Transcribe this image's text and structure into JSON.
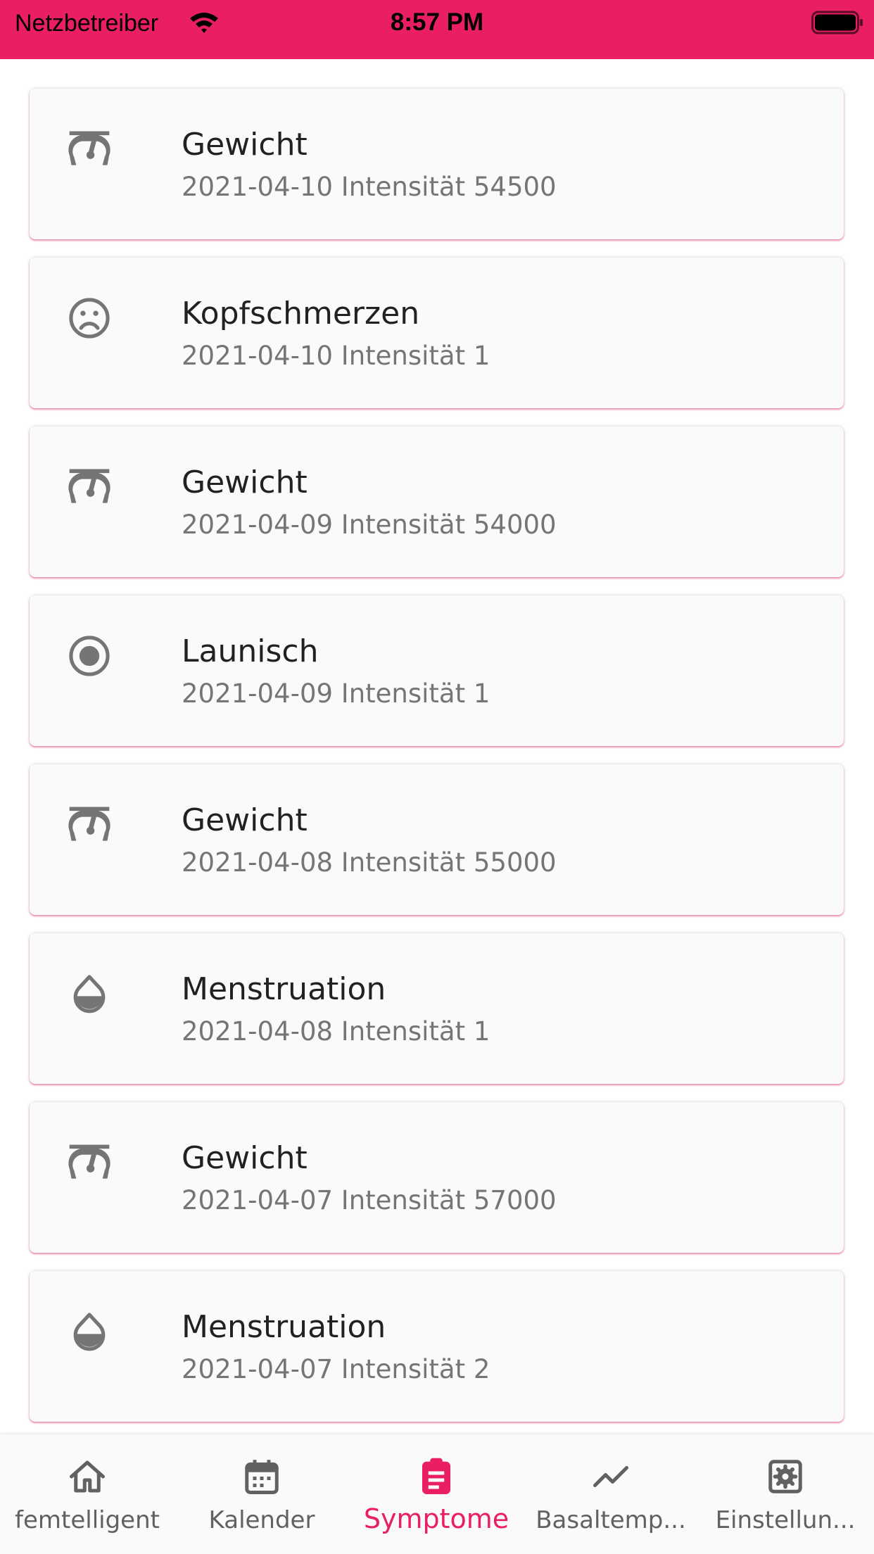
{
  "status_bar": {
    "carrier": "Netzbetreiber",
    "time": "8:57 PM"
  },
  "colors": {
    "accent": "#e91e63",
    "icon": "#757575",
    "title": "#212121",
    "subtitle": "#757575"
  },
  "entries": [
    {
      "icon": "scale-icon",
      "title": "Gewicht",
      "subtitle": "2021-04-10 Intensität 54500"
    },
    {
      "icon": "sad-face-icon",
      "title": "Kopfschmerzen",
      "subtitle": "2021-04-10 Intensität 1"
    },
    {
      "icon": "scale-icon",
      "title": "Gewicht",
      "subtitle": "2021-04-09 Intensität 54000"
    },
    {
      "icon": "radio-button-icon",
      "title": "Launisch",
      "subtitle": "2021-04-09 Intensität 1"
    },
    {
      "icon": "scale-icon",
      "title": "Gewicht",
      "subtitle": "2021-04-08 Intensität 55000"
    },
    {
      "icon": "drop-icon",
      "title": "Menstruation",
      "subtitle": "2021-04-08 Intensität 1"
    },
    {
      "icon": "scale-icon",
      "title": "Gewicht",
      "subtitle": "2021-04-07 Intensität 57000"
    },
    {
      "icon": "drop-icon",
      "title": "Menstruation",
      "subtitle": "2021-04-07 Intensität 2"
    }
  ],
  "tabs": [
    {
      "icon": "home-icon",
      "label": "femtelligent",
      "active": false
    },
    {
      "icon": "calendar-icon",
      "label": "Kalender",
      "active": false
    },
    {
      "icon": "clipboard-icon",
      "label": "Symptome",
      "active": true
    },
    {
      "icon": "trending-line-icon",
      "label": "Basaltemp...",
      "active": false
    },
    {
      "icon": "settings-icon",
      "label": "Einstellun...",
      "active": false
    }
  ]
}
